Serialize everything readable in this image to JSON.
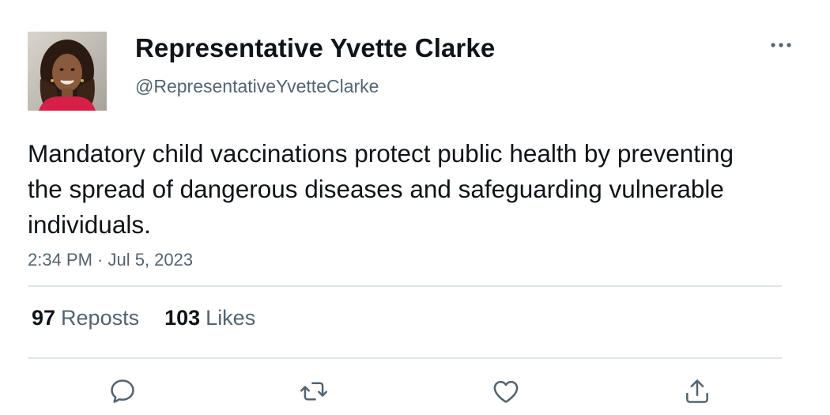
{
  "author": {
    "display_name": "Representative Yvette Clarke",
    "handle": "@RepresentativeYvetteClarke",
    "avatar_icon": "profile-photo"
  },
  "post": {
    "text": "Mandatory child vaccinations protect public health by preventing the spread of dangerous diseases and safeguarding vulnerable individuals.",
    "timestamp": "2:34 PM · Jul 5, 2023"
  },
  "stats": {
    "reposts_count": "97",
    "reposts_label": "Reposts",
    "likes_count": "103",
    "likes_label": "Likes"
  },
  "actions": [
    {
      "name": "reply",
      "icon": "reply-icon"
    },
    {
      "name": "repost",
      "icon": "repost-icon"
    },
    {
      "name": "like",
      "icon": "heart-icon"
    },
    {
      "name": "share",
      "icon": "share-icon"
    }
  ],
  "menu": {
    "icon": "more-icon"
  },
  "colors": {
    "text_primary": "#0f1419",
    "text_secondary": "#536471",
    "divider": "#e1e6ea",
    "icon": "#536471"
  }
}
